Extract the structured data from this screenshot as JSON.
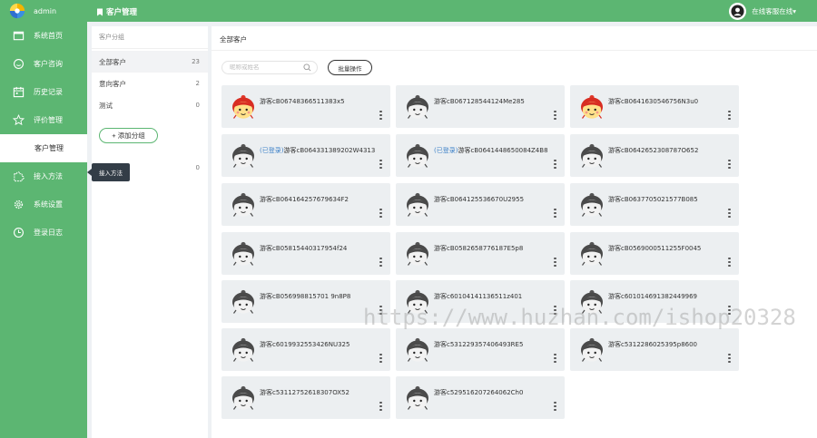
{
  "brand": {
    "name": "admin"
  },
  "colors": {
    "accent": "#5cb672",
    "card_bg": "#eceff1",
    "tooltip_bg": "#333d47",
    "tag": "#3a7fc7"
  },
  "sidebar": {
    "items": [
      {
        "label": "系统首页",
        "icon": "window-icon"
      },
      {
        "label": "客户咨询",
        "icon": "chat-circle-icon"
      },
      {
        "label": "历史记录",
        "icon": "calendar-icon"
      },
      {
        "label": "评价管理",
        "icon": "star-icon"
      },
      {
        "label": "客户管理",
        "icon": "",
        "active": true
      },
      {
        "label": "接入方法",
        "icon": "puzzle-icon"
      },
      {
        "label": "系统设置",
        "icon": "gear-icon"
      },
      {
        "label": "登录日志",
        "icon": "clock-icon"
      }
    ],
    "tooltip": "接入方法"
  },
  "header": {
    "title": "客户管理",
    "user_label": "在线客服在线▾"
  },
  "groups": {
    "heading": "客户分组",
    "items": [
      {
        "label": "全部客户",
        "count": "23"
      },
      {
        "label": "意向客户",
        "count": "2"
      },
      {
        "label": "测试",
        "count": "0"
      }
    ],
    "add_label": "+ 添加分组",
    "extra_count": "0"
  },
  "main": {
    "breadcrumb": "全部客户",
    "search_placeholder": "昵称或姓名",
    "batch_label": "批量操作"
  },
  "customers": [
    {
      "name": "游客cB06748366511383x5",
      "tag": "",
      "avatar": "red"
    },
    {
      "name": "游客cB067128544124Me285",
      "tag": "",
      "avatar": "gray"
    },
    {
      "name": "游客cB0641630546756N3u0",
      "tag": "",
      "avatar": "red"
    },
    {
      "name": "游客cB064331389202W4313",
      "tag": "(已登录)",
      "avatar": "gray"
    },
    {
      "name": "游客cB0641448650084Z4B8",
      "tag": "(已登录)",
      "avatar": "gray"
    },
    {
      "name": "游客cB0642652308787O652",
      "tag": "",
      "avatar": "gray"
    },
    {
      "name": "游客cB064164257679634F2",
      "tag": "",
      "avatar": "gray"
    },
    {
      "name": "游客cB064125536670U2955",
      "tag": "",
      "avatar": "gray"
    },
    {
      "name": "游客cB0637705021577B085",
      "tag": "",
      "avatar": "gray"
    },
    {
      "name": "游客cB05815440317954f24",
      "tag": "",
      "avatar": "gray"
    },
    {
      "name": "游客cB0582658776187E5p8",
      "tag": "",
      "avatar": "gray"
    },
    {
      "name": "游客cB0569000511255F0045",
      "tag": "",
      "avatar": "gray"
    },
    {
      "name": "游客cB056998815701 9n8P8",
      "tag": "",
      "avatar": "gray"
    },
    {
      "name": "游客c60104141136511z401",
      "tag": "",
      "avatar": "gray"
    },
    {
      "name": "游客c601014691382449969",
      "tag": "",
      "avatar": "gray"
    },
    {
      "name": "游客c6019932553426NU325",
      "tag": "",
      "avatar": "gray"
    },
    {
      "name": "游客c531229357406493RE5",
      "tag": "",
      "avatar": "gray"
    },
    {
      "name": "游客c5312286025395p8600",
      "tag": "",
      "avatar": "gray"
    },
    {
      "name": "游客c53112752618307OX52",
      "tag": "",
      "avatar": "gray"
    },
    {
      "name": "游客c529516207264062Ch0",
      "tag": "",
      "avatar": "gray"
    }
  ],
  "watermark": "https://www.huzhan.com/ishop20328"
}
